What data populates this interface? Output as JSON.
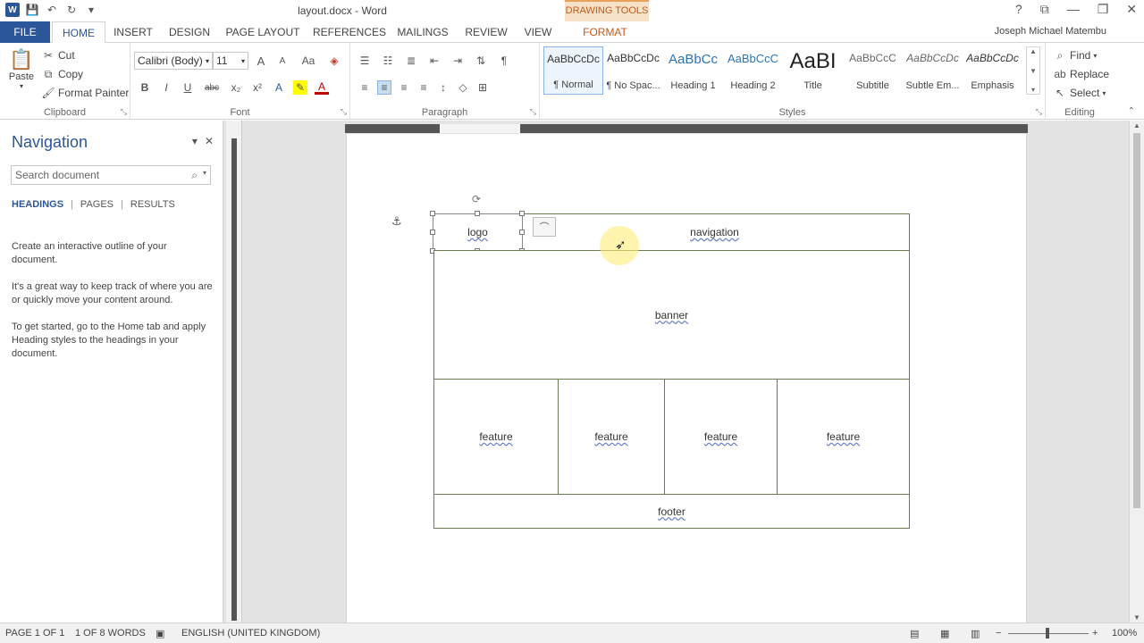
{
  "window": {
    "title": "layout.docx - Word",
    "contextual_tab_group": "DRAWING TOOLS",
    "controls": {
      "help": "?",
      "ribbon_options": "⧉",
      "minimize": "—",
      "restore": "❐",
      "close": "✕"
    }
  },
  "quick_access": {
    "undo": "↶",
    "redo": "↻"
  },
  "tabs": [
    {
      "label": "FILE",
      "active": false
    },
    {
      "label": "HOME",
      "active": true
    },
    {
      "label": "INSERT",
      "active": false
    },
    {
      "label": "DESIGN",
      "active": false
    },
    {
      "label": "PAGE LAYOUT",
      "active": false
    },
    {
      "label": "REFERENCES",
      "active": false
    },
    {
      "label": "MAILINGS",
      "active": false
    },
    {
      "label": "REVIEW",
      "active": false
    },
    {
      "label": "VIEW",
      "active": false
    },
    {
      "label": "FORMAT",
      "active": false
    }
  ],
  "user": {
    "name": "Joseph Michael Matembu"
  },
  "ribbon": {
    "clipboard": {
      "label": "Clipboard",
      "paste": "Paste",
      "cut": "Cut",
      "copy": "Copy",
      "format_painter": "Format Painter"
    },
    "font": {
      "label": "Font",
      "name": "Calibri (Body)",
      "size": "11",
      "bold": "B",
      "italic": "I",
      "underline": "U",
      "strikethrough": "abc",
      "subscript": "x₂",
      "superscript": "x²",
      "text_effects": "A",
      "font_color": "A",
      "grow": "A",
      "shrink": "A",
      "change_case": "Aa"
    },
    "paragraph": {
      "label": "Paragraph"
    },
    "styles": {
      "label": "Styles",
      "items": [
        {
          "preview": "AaBbCcDc",
          "name": "¶ Normal"
        },
        {
          "preview": "AaBbCcDc",
          "name": "¶ No Spac..."
        },
        {
          "preview": "AaBbCc",
          "name": "Heading 1"
        },
        {
          "preview": "AaBbCcC",
          "name": "Heading 2"
        },
        {
          "preview": "AaBI",
          "name": "Title"
        },
        {
          "preview": "AaBbCcC",
          "name": "Subtitle"
        },
        {
          "preview": "AaBbCcDc",
          "name": "Subtle Em..."
        },
        {
          "preview": "AaBbCcDc",
          "name": "Emphasis"
        }
      ]
    },
    "editing": {
      "label": "Editing",
      "find": "Find",
      "replace": "Replace",
      "select": "Select"
    }
  },
  "navigation": {
    "title": "Navigation",
    "search_placeholder": "Search document",
    "tabs": [
      "HEADINGS",
      "PAGES",
      "RESULTS"
    ],
    "help_text": [
      "Create an interactive outline of your document.",
      "It's a great way to keep track of where you are or quickly move your content around.",
      "To get started, go to the Home tab and apply Heading styles to the headings in your document."
    ]
  },
  "layout_shapes": {
    "logo": "logo",
    "navigation": "navigation",
    "banner": "banner",
    "features": [
      "feature",
      "feature",
      "feature",
      "feature"
    ],
    "footer": "footer"
  },
  "status_bar": {
    "page": "PAGE 1 OF 1",
    "words": "1 OF 8 WORDS",
    "language": "ENGLISH (UNITED KINGDOM)",
    "zoom": "100%"
  }
}
